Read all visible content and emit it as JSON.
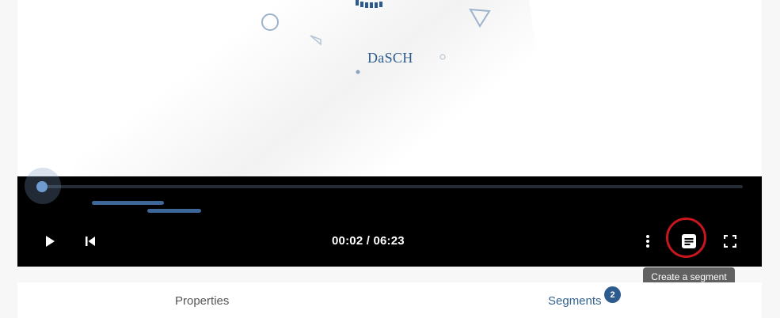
{
  "viewer": {
    "logo_text": "DaSCH"
  },
  "player": {
    "time_current": "00:02",
    "time_separator": " / ",
    "time_total": "06:23",
    "time_display": "00:02 / 06:23",
    "progress_fraction": 0.005,
    "buttons": {
      "play": "play-icon",
      "rewind": "skip-previous-icon",
      "more": "more-vert-icon",
      "create_segment": "segment-icon",
      "fullscreen": "fullscreen-icon"
    }
  },
  "tooltip": {
    "text": "Create a segment"
  },
  "tabs": [
    {
      "label": "Properties"
    },
    {
      "label": "Segments",
      "badge": "2"
    }
  ],
  "colors": {
    "accent": "#2d5b8e",
    "highlight": "#c8161d",
    "segment_bar": "#3d6798"
  }
}
